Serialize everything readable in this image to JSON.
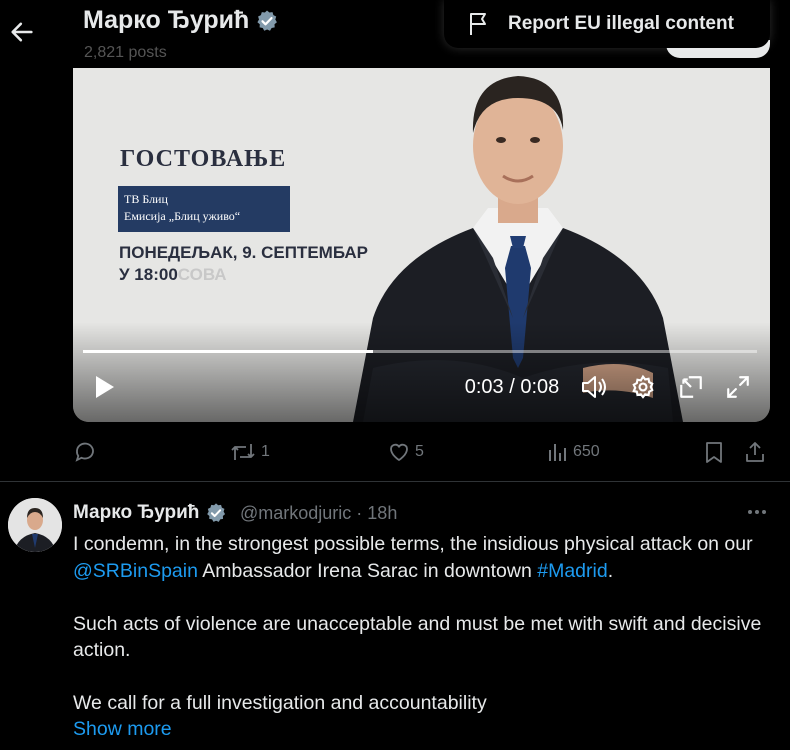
{
  "header": {
    "name": "Марко Ђурић",
    "posts": "2,821 posts",
    "back_icon": "arrow-left-icon",
    "report_label": "Report EU illegal content"
  },
  "video": {
    "title": "ГОСТОВАЊЕ",
    "box_line1": "ТВ Блиц",
    "box_line2": "Емисија „Блиц уживо“",
    "date": "ПОНЕДЕЉАК, 9. СЕПТЕМБАР",
    "time_main": "У 18:00",
    "time_unit": "СОВА",
    "time_display": "0:03 / 0:08",
    "progress": 0.43
  },
  "actions": {
    "reply_count": "",
    "retweet_count": "1",
    "like_count": "5",
    "views_count": "650"
  },
  "tweet": {
    "name": "Марко Ђурић",
    "handle": "@markodjuric · 18h",
    "line1_pre": "I condemn, in the strongest possible terms, the insidious physical attack on our ",
    "mention": "@SRBinSpain",
    "line1_mid": " Ambassador Irena Sarac in downtown ",
    "hashtag": "#Madrid",
    "line1_end": ".",
    "para2": "Such acts of violence are unacceptable and must be met with swift and decisive action.",
    "para3": "We call for a full investigation and accountability",
    "show_more": "Show more"
  },
  "colors": {
    "link": "#1d9bf0",
    "muted": "#71767b",
    "verified": "#829aab",
    "video_bg": "#e6e6e4",
    "box_bg": "#243b63"
  }
}
